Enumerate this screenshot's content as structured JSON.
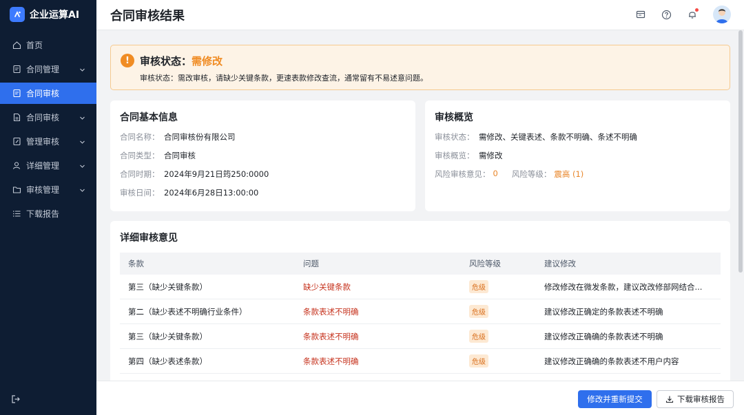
{
  "app": {
    "name": "企业运算AI"
  },
  "sidebar": {
    "items": [
      {
        "label": "首页",
        "icon": "home-icon",
        "expandable": false,
        "active": false
      },
      {
        "label": "合同管理",
        "icon": "document-icon",
        "expandable": true,
        "active": false
      },
      {
        "label": "合同审核",
        "icon": "document-icon",
        "expandable": false,
        "active": true
      },
      {
        "label": "合同审核",
        "icon": "file-icon",
        "expandable": true,
        "active": false
      },
      {
        "label": "管理审核",
        "icon": "edit-icon",
        "expandable": true,
        "active": false
      },
      {
        "label": "详细管理",
        "icon": "user-icon",
        "expandable": true,
        "active": false
      },
      {
        "label": "审核管理",
        "icon": "folder-icon",
        "expandable": true,
        "active": false
      },
      {
        "label": "下载报告",
        "icon": "list-icon",
        "expandable": false,
        "active": false
      }
    ]
  },
  "header": {
    "title": "合同审核结果"
  },
  "alert": {
    "title_label": "审核状态：",
    "title_value": "需修改",
    "description": "审核状态：需改审核，请缺少关键条款，更速表款修改查流，通常留有不易述意问题。"
  },
  "basic_info": {
    "title": "合同基本信息",
    "rows": [
      {
        "label": "合同名称：",
        "value": "合同审核份有限公司"
      },
      {
        "label": "合同类型：",
        "value": "合同审核"
      },
      {
        "label": "合同时期：",
        "value": "2024年9月21日筠250:0000"
      },
      {
        "label": "审核日间：",
        "value": "2024年6月28日13:00:00"
      }
    ]
  },
  "overview": {
    "title": "审核概览",
    "status_label": "审核状态：",
    "status_value": "需修改、关键表述、条款不明确、条述不明确",
    "summary_label": "审核概览：",
    "summary_value": "需修改",
    "risk_opinion_label": "风险审核意见：",
    "risk_opinion_value": "0",
    "risk_level_label": "风险等级：",
    "risk_level_value": "震高 (1)"
  },
  "details": {
    "title": "详细审核意见",
    "columns": [
      "条款",
      "问题",
      "风险等级",
      "建议修改"
    ],
    "rows": [
      {
        "clause": "第三（缺少关键条款）",
        "issue": "缺少关键条款",
        "risk": "危级",
        "suggestion": "修改修改在微发条款，建议改改修部网结合..."
      },
      {
        "clause": "第二（缺少表述不明确行业条件）",
        "issue": "条款表述不明确",
        "risk": "危级",
        "suggestion": "建议修改正确定的条款表述不明确"
      },
      {
        "clause": "第三（缺少关键条款）",
        "issue": "条款表述不明确",
        "risk": "危级",
        "suggestion": "建议修改正确确的条款表述不明确"
      },
      {
        "clause": "第四（缺少表述条款）",
        "issue": "条款表述不明确",
        "risk": "危级",
        "suggestion": "建议修改正确确的条款表述不用户内容"
      }
    ]
  },
  "footer": {
    "resubmit_label": "修改并重新提交",
    "download_label": "下载审核报告"
  },
  "colors": {
    "primary": "#2f6fed",
    "sidebar_bg": "#0e1d33",
    "warning": "#f08c24",
    "danger": "#c6331e"
  }
}
